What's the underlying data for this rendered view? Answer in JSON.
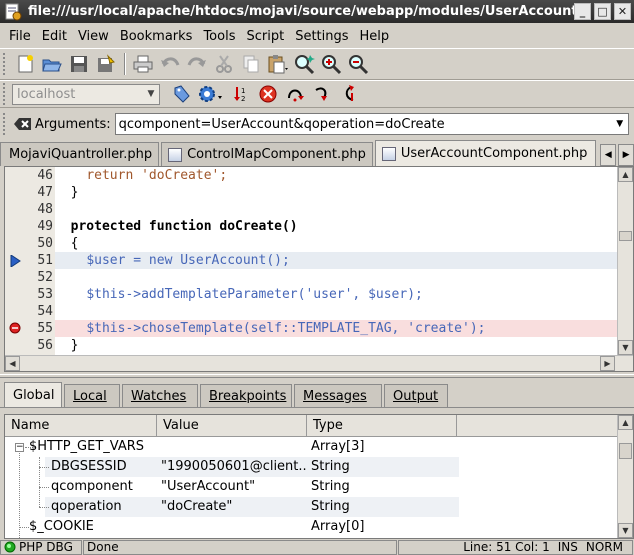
{
  "window": {
    "title": "file:///usr/local/apache/htdocs/mojavi/source/webapp/modules/UserAccount/U"
  },
  "menubar": {
    "items": [
      "File",
      "Edit",
      "View",
      "Bookmarks",
      "Tools",
      "Script",
      "Settings",
      "Help"
    ]
  },
  "toolbar2": {
    "host_value": "localhost"
  },
  "args": {
    "label": "Arguments:",
    "value": "qcomponent=UserAccount&qoperation=doCreate"
  },
  "file_tabs": [
    "MojaviQuantroller.php",
    "ControlMapComponent.php",
    "UserAccountComponent.php"
  ],
  "code": {
    "lines": [
      {
        "num": "46",
        "text": "return 'doCreate';"
      },
      {
        "num": "47",
        "text": "}"
      },
      {
        "num": "48",
        "text": ""
      },
      {
        "num": "49",
        "text": "protected function doCreate()"
      },
      {
        "num": "50",
        "text": "{"
      },
      {
        "num": "51",
        "text": "$user = new UserAccount();"
      },
      {
        "num": "52",
        "text": ""
      },
      {
        "num": "53",
        "text": "$this->addTemplateParameter('user', $user);"
      },
      {
        "num": "54",
        "text": ""
      },
      {
        "num": "55",
        "text": "$this->choseTemplate(self::TEMPLATE_TAG, 'create');"
      },
      {
        "num": "56",
        "text": "}"
      }
    ]
  },
  "bottom_tabs": [
    "Global",
    "Local",
    "Watches",
    "Breakpoints",
    "Messages",
    "Output"
  ],
  "variables": {
    "columns": [
      "Name",
      "Value",
      "Type"
    ],
    "rows": [
      {
        "name": "$HTTP_GET_VARS",
        "value": "",
        "type": "Array[3]"
      },
      {
        "name": "DBGSESSID",
        "value": "\"1990050601@client...",
        "type": "String"
      },
      {
        "name": "qcomponent",
        "value": "\"UserAccount\"",
        "type": "String"
      },
      {
        "name": "qoperation",
        "value": "\"doCreate\"",
        "type": "String"
      },
      {
        "name": "$_COOKIE",
        "value": "",
        "type": "Array[0]"
      }
    ]
  },
  "status": {
    "debugger": "PHP DBG",
    "state": "Done",
    "position": "Line: 51 Col: 1",
    "mode": "INS",
    "insert": "NORM"
  },
  "colors": {
    "current_line": "#e7ecf2",
    "breakpoint_line": "#f9dede",
    "string": "#a0572c",
    "variable": "#4767b8"
  }
}
